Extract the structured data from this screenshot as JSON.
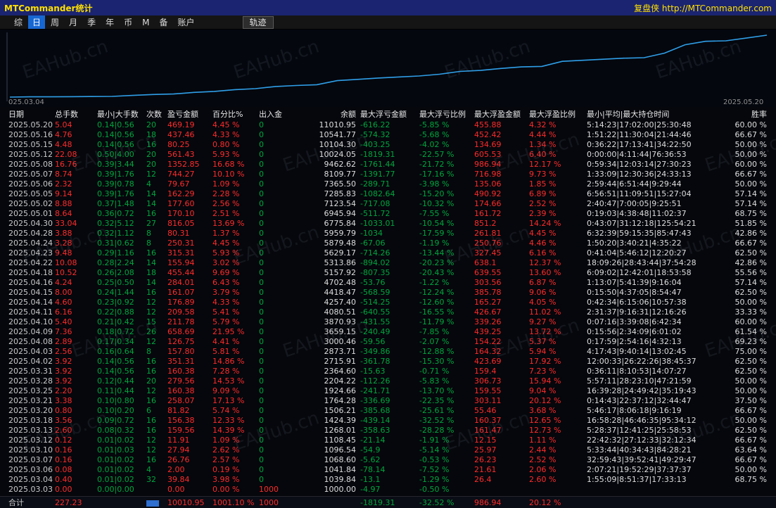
{
  "titlebar": {
    "title": "MTCommander统计",
    "right_text": "复盘侠 http://MTCommander.com"
  },
  "menu": {
    "items": [
      "综",
      "日",
      "周",
      "月",
      "季",
      "年",
      "币",
      "M",
      "备",
      "账户"
    ],
    "active_index": 1,
    "track_label": "轨迹"
  },
  "watermark": "EAHub.cn",
  "colors": {
    "titlebar_blue": "#1a2470",
    "title_yellow": "#ffe000",
    "curve_blue": "#2f9fe8",
    "profit_red": "#ff2b2b",
    "loss_green": "#00a63e",
    "active_menu_blue": "#1767d2"
  },
  "chart": {
    "type": "line",
    "x_start_label": "025.03.04",
    "x_end_label": "2025.05.20",
    "line_color": "#2f9fe8",
    "balances": [
      1000.0,
      1039.84,
      1041.84,
      1068.6,
      1096.54,
      1108.45,
      1268.01,
      1424.39,
      1506.21,
      1764.28,
      1924.66,
      2204.22,
      2364.6,
      2715.91,
      2873.71,
      3000.46,
      3659.15,
      3870.93,
      4080.51,
      4257.4,
      4418.47,
      4702.48,
      5157.92,
      5313.86,
      5629.17,
      5879.48,
      5959.79,
      6775.84,
      6945.94,
      7123.54,
      7285.83,
      7365.5,
      8109.77,
      9462.62,
      10024.05,
      10104.3,
      10541.77,
      11010.95
    ]
  },
  "table": {
    "columns": [
      {
        "label": "日期",
        "cls": "dim"
      },
      {
        "label": "总手数",
        "cls": "red"
      },
      {
        "label": "最小|大手数",
        "cls": "green"
      },
      {
        "label": "次数",
        "cls": "green"
      },
      {
        "label": "盈亏金额",
        "cls": "red"
      },
      {
        "label": "百分比%",
        "cls": "red"
      },
      {
        "label": "出入金",
        "cls": "green",
        "nonzero": "red"
      },
      {
        "label": "余额",
        "cls": "white",
        "align": "right"
      },
      {
        "label": "最大浮亏金额",
        "cls": "green"
      },
      {
        "label": "最大浮亏比例",
        "cls": "green"
      },
      {
        "label": "最大浮盈金额",
        "cls": "red"
      },
      {
        "label": "最大浮盈比例",
        "cls": "red"
      },
      {
        "label": "最小|平均|最大持仓时间",
        "cls": "white"
      },
      {
        "label": "胜率",
        "cls": "white",
        "align": "right"
      }
    ],
    "rows": [
      [
        "2025.05.20",
        "5.04",
        "0.14|0.56",
        "20",
        "469.19",
        "4.45 %",
        "0",
        "11010.95",
        "-616.22",
        "-5.85 %",
        "455.88",
        "4.32 %",
        "5:14:23|17:02:00|25:30:48",
        "60.00 %"
      ],
      [
        "2025.05.16",
        "4.76",
        "0.14|0.56",
        "18",
        "437.46",
        "4.33 %",
        "0",
        "10541.77",
        "-574.32",
        "-5.68 %",
        "452.42",
        "4.44 %",
        "1:51:22|11:30:04|21:44:46",
        "66.67 %"
      ],
      [
        "2025.05.15",
        "4.48",
        "0.14|0.56",
        "16",
        "80.25",
        "0.80 %",
        "0",
        "10104.30",
        "-403.25",
        "-4.02 %",
        "134.69",
        "1.34 %",
        "0:36:22|17:13:41|34:22:50",
        "50.00 %"
      ],
      [
        "2025.05.12",
        "22.08",
        "0.50|4.00",
        "20",
        "561.43",
        "5.93 %",
        "0",
        "10024.05",
        "-1819.31",
        "-22.57 %",
        "605.53",
        "6.40 %",
        "0:00:00|4:11:44|76:36:53",
        "50.00 %"
      ],
      [
        "2025.05.08",
        "16.76",
        "0.39|3.44",
        "20",
        "1352.85",
        "16.68 %",
        "0",
        "9462.62",
        "-1761.44",
        "-21.72 %",
        "986.94",
        "12.17 %",
        "0:59:34|12:03:14|27:30:23",
        "60.00 %"
      ],
      [
        "2025.05.07",
        "8.74",
        "0.39|1.76",
        "12",
        "744.27",
        "10.10 %",
        "0",
        "8109.77",
        "-1391.77",
        "-17.16 %",
        "716.98",
        "9.73 %",
        "1:33:09|12:30:36|24:33:13",
        "66.67 %"
      ],
      [
        "2025.05.06",
        "2.32",
        "0.39|0.78",
        "4",
        "79.67",
        "1.09 %",
        "0",
        "7365.50",
        "-289.71",
        "-3.98 %",
        "135.06",
        "1.85 %",
        "2:59:44|6:51:44|9:29:44",
        "50.00 %"
      ],
      [
        "2025.05.05",
        "9.14",
        "0.39|1.76",
        "14",
        "162.29",
        "2.28 %",
        "0",
        "7285.83",
        "-1082.64",
        "-15.20 %",
        "490.92",
        "6.89 %",
        "6:56:51|11:09:51|15:27:04",
        "57.14 %"
      ],
      [
        "2025.05.02",
        "8.88",
        "0.37|1.48",
        "14",
        "177.60",
        "2.56 %",
        "0",
        "7123.54",
        "-717.08",
        "-10.32 %",
        "174.66",
        "2.52 %",
        "2:40:47|7:00:05|9:25:51",
        "57.14 %"
      ],
      [
        "2025.05.01",
        "8.64",
        "0.36|0.72",
        "16",
        "170.10",
        "2.51 %",
        "0",
        "6945.94",
        "-511.72",
        "-7.55 %",
        "161.72",
        "2.39 %",
        "0:19:03|4:38:48|11:02:37",
        "68.75 %"
      ],
      [
        "2025.04.30",
        "33.04",
        "0.32|5.12",
        "27",
        "816.05",
        "13.69 %",
        "0",
        "6775.84",
        "-1033.01",
        "-10.54 %",
        "851.2",
        "14.24 %",
        "0:43:07|31:12:18|125:54:21",
        "51.85 %"
      ],
      [
        "2025.04.28",
        "3.88",
        "0.32|1.12",
        "8",
        "80.31",
        "1.37 %",
        "0",
        "5959.79",
        "-1034",
        "-17.59 %",
        "261.81",
        "4.45 %",
        "6:32:39|59:15:35|85:47:43",
        "42.86 %"
      ],
      [
        "2025.04.24",
        "3.28",
        "0.31|0.62",
        "8",
        "250.31",
        "4.45 %",
        "0",
        "5879.48",
        "-67.06",
        "-1.19 %",
        "250.76",
        "4.46 %",
        "1:50:20|3:40:21|4:35:22",
        "66.67 %"
      ],
      [
        "2025.04.23",
        "9.48",
        "0.29|1.16",
        "16",
        "315.31",
        "5.93 %",
        "0",
        "5629.17",
        "-714.26",
        "-13.44 %",
        "327.45",
        "6.16 %",
        "0:41:04|5:46:12|12:20:27",
        "62.50 %"
      ],
      [
        "2025.04.22",
        "10.08",
        "0.28|2.24",
        "14",
        "155.94",
        "3.02 %",
        "0",
        "5313.86",
        "-894.02",
        "-20.23 %",
        "638.1",
        "12.37 %",
        "18:09:26|28:43:44|37:54:28",
        "42.86 %"
      ],
      [
        "2025.04.18",
        "10.52",
        "0.26|2.08",
        "18",
        "455.44",
        "9.69 %",
        "0",
        "5157.92",
        "-807.35",
        "-20.43 %",
        "639.55",
        "13.60 %",
        "6:09:02|12:42:01|18:53:58",
        "55.56 %"
      ],
      [
        "2025.04.16",
        "4.24",
        "0.25|0.50",
        "14",
        "284.01",
        "6.43 %",
        "0",
        "4702.48",
        "-53.76",
        "-1.22 %",
        "303.56",
        "6.87 %",
        "1:13:07|5:41:39|9:16:04",
        "57.14 %"
      ],
      [
        "2025.04.15",
        "8.00",
        "0.24|1.44",
        "16",
        "161.07",
        "3.79 %",
        "0",
        "4418.47",
        "-568.59",
        "-12.24 %",
        "385.78",
        "9.06 %",
        "0:15:50|4:37:05|8:54:47",
        "62.50 %"
      ],
      [
        "2025.04.14",
        "4.60",
        "0.23|0.92",
        "12",
        "176.89",
        "4.33 %",
        "0",
        "4257.40",
        "-514.25",
        "-12.60 %",
        "165.27",
        "4.05 %",
        "0:42:34|6:15:06|10:57:38",
        "50.00 %"
      ],
      [
        "2025.04.11",
        "6.16",
        "0.22|0.88",
        "12",
        "209.58",
        "5.41 %",
        "0",
        "4080.51",
        "-640.55",
        "-16.55 %",
        "426.67",
        "11.02 %",
        "2:31:37|9:16:31|12:16:26",
        "33.33 %"
      ],
      [
        "2025.04.10",
        "5.40",
        "0.21|0.42",
        "15",
        "211.78",
        "5.79 %",
        "0",
        "3870.93",
        "-431.55",
        "-11.79 %",
        "339.26",
        "9.27 %",
        "0:07:16|3:39:08|6:42:34",
        "60.00 %"
      ],
      [
        "2025.04.09",
        "7.36",
        "0.18|0.72",
        "26",
        "658.69",
        "21.95 %",
        "0",
        "3659.15",
        "-240.49",
        "-7.85 %",
        "439.25",
        "13.72 %",
        "0:15:56|2:34:09|6:01:02",
        "61.54 %"
      ],
      [
        "2025.04.08",
        "2.89",
        "0.17|0.34",
        "12",
        "126.75",
        "4.41 %",
        "0",
        "3000.46",
        "-59.56",
        "-2.07 %",
        "154.22",
        "5.37 %",
        "0:17:59|2:54:16|4:32:13",
        "69.23 %"
      ],
      [
        "2025.04.03",
        "2.56",
        "0.16|0.64",
        "8",
        "157.80",
        "5.81 %",
        "0",
        "2873.71",
        "-349.86",
        "-12.88 %",
        "164.32",
        "5.94 %",
        "4:17:43|9:40:14|13:02:45",
        "75.00 %"
      ],
      [
        "2025.04.02",
        "3.92",
        "0.14|0.56",
        "16",
        "351.31",
        "14.86 %",
        "0",
        "2715.91",
        "-361.78",
        "-15.30 %",
        "423.69",
        "17.92 %",
        "12:00:33|26:22:26|38:45:37",
        "62.50 %"
      ],
      [
        "2025.03.31",
        "3.92",
        "0.14|0.56",
        "16",
        "160.38",
        "7.28 %",
        "0",
        "2364.60",
        "-15.63",
        "-0.71 %",
        "159.4",
        "7.23 %",
        "0:36:11|8:10:53|14:07:27",
        "62.50 %"
      ],
      [
        "2025.03.28",
        "3.92",
        "0.12|0.44",
        "20",
        "279.56",
        "14.53 %",
        "0",
        "2204.22",
        "-112.26",
        "-5.83 %",
        "306.73",
        "15.94 %",
        "5:57:11|28:23:10|47:21:59",
        "50.00 %"
      ],
      [
        "2025.03.25",
        "2.20",
        "0.11|0.44",
        "12",
        "160.38",
        "9.09 %",
        "0",
        "1924.66",
        "-241.71",
        "-13.70 %",
        "159.55",
        "9.04 %",
        "16:39:28|24:49:42|35:19:43",
        "50.00 %"
      ],
      [
        "2025.03.21",
        "3.38",
        "0.10|0.80",
        "16",
        "258.07",
        "17.13 %",
        "0",
        "1764.28",
        "-336.69",
        "-22.35 %",
        "303.11",
        "20.12 %",
        "0:14:43|22:37:12|32:44:47",
        "37.50 %"
      ],
      [
        "2025.03.20",
        "0.80",
        "0.10|0.20",
        "6",
        "81.82",
        "5.74 %",
        "0",
        "1506.21",
        "-385.68",
        "-25.61 %",
        "55.46",
        "3.68 %",
        "5:46:17|8:06:18|9:16:19",
        "66.67 %"
      ],
      [
        "2025.03.18",
        "3.56",
        "0.09|0.72",
        "16",
        "156.38",
        "12.33 %",
        "0",
        "1424.39",
        "-439.14",
        "-32.52 %",
        "160.37",
        "12.65 %",
        "16:58:28|46:46:35|95:34:12",
        "50.00 %"
      ],
      [
        "2025.03.13",
        "2.60",
        "0.08|0.32",
        "16",
        "159.56",
        "14.39 %",
        "0",
        "1268.01",
        "-358.63",
        "-28.28 %",
        "161.47",
        "12.73 %",
        "5:28:37|12:41:25|25:58:53",
        "62.50 %"
      ],
      [
        "2025.03.12",
        "0.12",
        "0.01|0.02",
        "12",
        "11.91",
        "1.09 %",
        "0",
        "1108.45",
        "-21.14",
        "-1.91 %",
        "12.15",
        "1.11 %",
        "22:42:32|27:12:33|32:12:34",
        "66.67 %"
      ],
      [
        "2025.03.10",
        "0.16",
        "0.01|0.03",
        "12",
        "27.94",
        "2.62 %",
        "0",
        "1096.54",
        "-54.9",
        "-5.14 %",
        "25.97",
        "2.44 %",
        "5:33:44|40:34:43|84:28:21",
        "63.64 %"
      ],
      [
        "2025.03.07",
        "0.16",
        "0.01|0.02",
        "16",
        "26.76",
        "2.57 %",
        "0",
        "1068.60",
        "-5.62",
        "-0.53 %",
        "26.23",
        "2.52 %",
        "32:59:43|39:52:41|49:29:47",
        "66.67 %"
      ],
      [
        "2025.03.06",
        "0.08",
        "0.01|0.02",
        "4",
        "2.00",
        "0.19 %",
        "0",
        "1041.84",
        "-78.14",
        "-7.52 %",
        "21.61",
        "2.06 %",
        "2:07:21|19:52:29|37:37:37",
        "50.00 %"
      ],
      [
        "2025.03.04",
        "0.40",
        "0.01|0.02",
        "32",
        "39.84",
        "3.98 %",
        "0",
        "1039.84",
        "-13.1",
        "-1.29 %",
        "26.4",
        "2.60 %",
        "1:55:09|8:51:37|17:33:13",
        "68.75 %"
      ],
      [
        "2025.03.03",
        "0.00",
        "0.00|0.00",
        "",
        "0.00",
        "0.00 %",
        "1000",
        "1000.00",
        "-4.97",
        "-0.50 %",
        "",
        "",
        "",
        ""
      ]
    ],
    "total": [
      "合计",
      "227.23",
      "",
      "",
      "10010.95",
      "1001.10 %",
      "1000",
      "",
      "-1819.31",
      "-32.52 %",
      "986.94",
      "20.12 %",
      "",
      ""
    ]
  }
}
